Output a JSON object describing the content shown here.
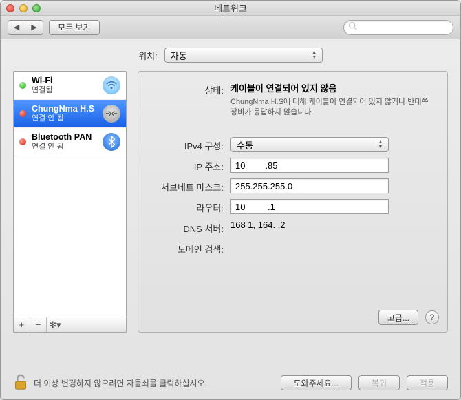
{
  "window": {
    "title": "네트워크"
  },
  "toolbar": {
    "back": "◀",
    "forward": "▶",
    "show_all": "모두 보기",
    "search_placeholder": ""
  },
  "location": {
    "label": "위치:",
    "value": "자동"
  },
  "services": [
    {
      "name": "Wi-Fi",
      "status": "연결됨",
      "dot": "green",
      "icon": "wifi",
      "selected": false
    },
    {
      "name": "ChungNma H.S",
      "status": "연결 안 됨",
      "dot": "red",
      "icon": "eth",
      "selected": true
    },
    {
      "name": "Bluetooth PAN",
      "status": "연결 안 됨",
      "dot": "red",
      "icon": "bt",
      "selected": false
    }
  ],
  "sidebar_tools": {
    "add": "+",
    "remove": "−",
    "gear": "✻▾"
  },
  "detail": {
    "status_label": "상태:",
    "status_title": "케이블이 연결되어 있지 않음",
    "status_desc": "ChungNma H.S에 대해 케이블이 연결되어 있지 않거나 반대쪽 장비가 응답하지 않습니다.",
    "ipv4_config_label": "IPv4 구성:",
    "ipv4_config_value": "수동",
    "ip_label": "IP 주소:",
    "ip_value": "10        .85",
    "subnet_label": "서브네트 마스크:",
    "subnet_value": "255.255.255.0",
    "router_label": "라우터:",
    "router_value": "10         .1",
    "dns_label": "DNS 서버:",
    "dns_value": "168           1, 164.           .2",
    "search_domains_label": "도메인 검색:",
    "advanced": "고급..."
  },
  "footer": {
    "lock_text": "더 이상 변경하지 않으려면 자물쇠를 클릭하십시오.",
    "assist": "도와주세요...",
    "revert": "복귀",
    "apply": "적용"
  }
}
